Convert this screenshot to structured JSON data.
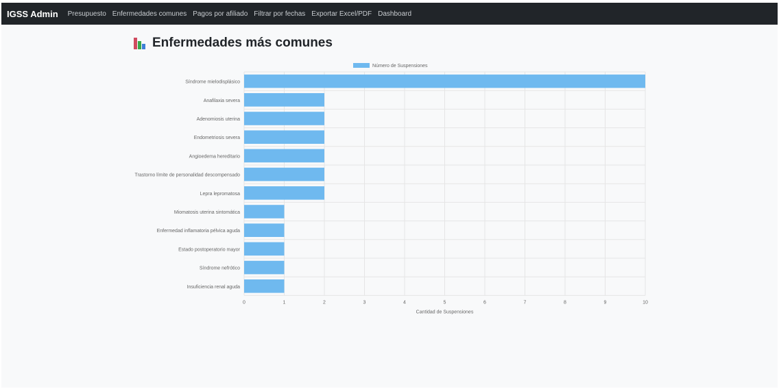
{
  "navbar": {
    "brand": "IGSS Admin",
    "links": [
      "Presupuesto",
      "Enfermedades comunes",
      "Pagos por afiliado",
      "Filtrar por fechas",
      "Exportar Excel/PDF",
      "Dashboard"
    ]
  },
  "page": {
    "title": "Enfermedades más comunes",
    "title_icon": "bar-chart-icon"
  },
  "colors": {
    "navbar_bg": "#212529",
    "bar_fill": "#6fb9ef",
    "grid": "#e5e5e5",
    "tick_text": "#666666"
  },
  "chart_data": {
    "type": "bar",
    "orientation": "horizontal",
    "title": "",
    "xlabel": "Cantidad de Suspensiones",
    "ylabel": "",
    "xlim": [
      0,
      10
    ],
    "xticks": [
      0,
      1,
      2,
      3,
      4,
      5,
      6,
      7,
      8,
      9,
      10
    ],
    "grid": true,
    "legend_position": "top",
    "categories": [
      "Síndrome mielodisplásico",
      "Anafilaxia severa",
      "Adenomiosis uterina",
      "Endometriosis severa",
      "Angioedema hereditario",
      "Trastorno límite de personalidad descompensado",
      "Lepra lepromatosa",
      "Miomatosis uterina sintomática",
      "Enfermedad inflamatoria pélvica aguda",
      "Estado postoperatorio mayor",
      "Síndrome nefrótico",
      "Insuficiencia renal aguda"
    ],
    "series": [
      {
        "name": "Número de Suspensiones",
        "values": [
          10,
          2,
          2,
          2,
          2,
          2,
          2,
          1,
          1,
          1,
          1,
          1
        ]
      }
    ]
  }
}
